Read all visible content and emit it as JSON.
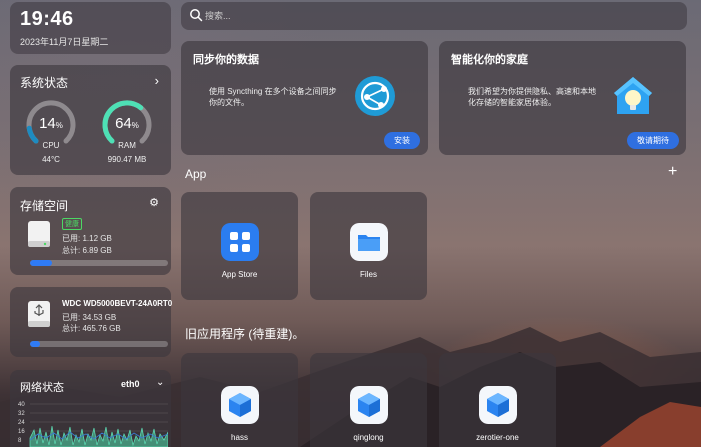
{
  "clock": {
    "time": "19:46",
    "date": "2023年11月7日星期二"
  },
  "system": {
    "title": "系统状态",
    "cpu": {
      "percent": 14,
      "unit": "%",
      "label": "CPU",
      "sub": "44°C",
      "color": "#1e8bc0"
    },
    "ram": {
      "percent": 64,
      "unit": "%",
      "label": "RAM",
      "sub": "990.47 MB",
      "color": "#4ee0b5"
    }
  },
  "storage": {
    "title": "存储空间",
    "badge": "健康",
    "used": "已用: 1.12 GB",
    "total": "总计: 6.89 GB",
    "used_fraction": 0.16
  },
  "usb_disk": {
    "name": "WDC WD5000BEVT-24A0RT0",
    "used": "已用: 34.53 GB",
    "total": "总计: 465.76 GB",
    "used_fraction": 0.07
  },
  "network": {
    "title": "网络状态",
    "interface": "eth0",
    "ticks": [
      "40",
      "32",
      "24",
      "16",
      "8"
    ]
  },
  "search": {
    "placeholder": "搜索..."
  },
  "cards": {
    "sync": {
      "title": "同步你的数据",
      "desc": "使用 Syncthing 在多个设备之间同步你的文件。",
      "button": "安装"
    },
    "home": {
      "title": "智能化你的家庭",
      "desc": "我们希望为你提供隐私、高速和本地化存储的智能家居体验。",
      "button": "敬请期待"
    }
  },
  "sections": {
    "apps": "App",
    "legacy": "旧应用程序 (待重建)。"
  },
  "apps": [
    {
      "label": "App Store",
      "icon": "app-store-icon"
    },
    {
      "label": "Files",
      "icon": "folder-icon"
    }
  ],
  "legacy_apps": [
    {
      "label": "hass",
      "icon": "cube-icon"
    },
    {
      "label": "qinglong",
      "icon": "cube-icon"
    },
    {
      "label": "zerotier-one",
      "icon": "cube-icon"
    }
  ]
}
